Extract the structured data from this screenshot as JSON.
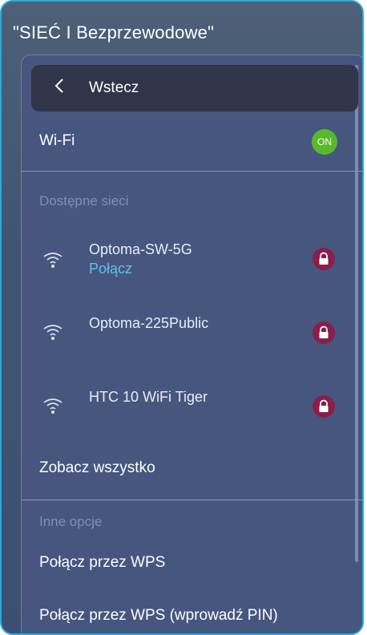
{
  "title": "\"SIEĆ I Bezprzewodowe\"",
  "back_label": "Wstecz",
  "wifi": {
    "label": "Wi-Fi",
    "toggle_state": "ON"
  },
  "available_section": "Dostępne sieci",
  "networks": [
    {
      "name": "Optoma-SW-5G",
      "status": "Połącz",
      "icon": "wifi-icon",
      "secured": true
    },
    {
      "name": "Optoma-225Public",
      "status": "",
      "icon": "wifi-icon",
      "secured": true
    },
    {
      "name": "HTC 10 WiFi Tiger",
      "status": "",
      "icon": "wifi-icon",
      "secured": true
    }
  ],
  "see_all": "Zobacz wszystko",
  "other_section": "Inne opcje",
  "options": [
    "Połącz przez WPS",
    "Połącz przez WPS (wprowadź PIN)"
  ],
  "colors": {
    "accent_border": "#2aa8dc",
    "toggle_on": "#5ab82d",
    "lock": "#8a1e48",
    "link": "#5ec2ea"
  }
}
